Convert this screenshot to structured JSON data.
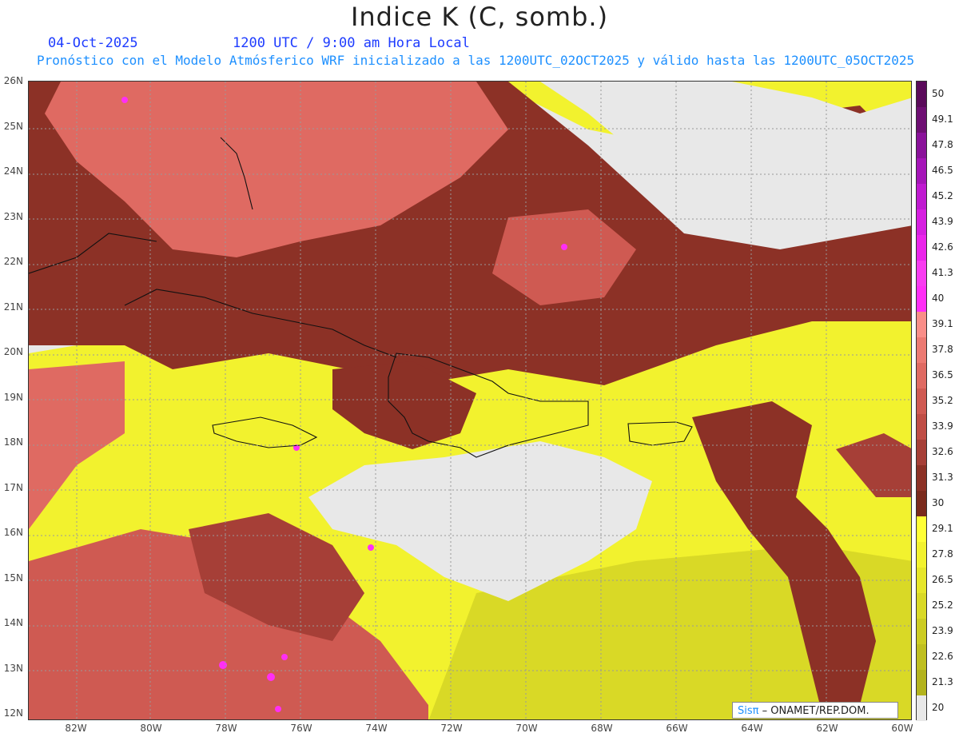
{
  "header": {
    "title": "Indice K (C, somb.)",
    "date": "04-Oct-2025",
    "time": "1200 UTC / 9:00 am Hora Local",
    "description": "Pronóstico con el Modelo Atmósferico WRF inicializado a las 1200UTC_02OCT2025 y válido hasta las  1200UTC_05OCT2025"
  },
  "axes": {
    "lat_labels": [
      "26N",
      "25N",
      "24N",
      "23N",
      "22N",
      "21N",
      "20N",
      "19N",
      "18N",
      "17N",
      "16N",
      "15N",
      "14N",
      "13N",
      "12N"
    ],
    "lon_labels": [
      "82W",
      "80W",
      "78W",
      "76W",
      "74W",
      "72W",
      "70W",
      "68W",
      "66W",
      "64W",
      "62W",
      "60W"
    ]
  },
  "legend": {
    "labels": [
      "50",
      "49.1",
      "47.8",
      "46.5",
      "45.2",
      "43.9",
      "42.6",
      "41.3",
      "40",
      "39.1",
      "37.8",
      "36.5",
      "35.2",
      "33.9",
      "32.6",
      "31.3",
      "30",
      "29.1",
      "27.8",
      "26.5",
      "25.2",
      "23.9",
      "22.6",
      "21.3",
      "20"
    ],
    "colors": [
      "#5a0a5a",
      "#6e0f73",
      "#8a129a",
      "#a515b8",
      "#bf1ad0",
      "#d61fe0",
      "#ea24ea",
      "#f83cf0",
      "#ff2ef5",
      "#f98e88",
      "#ec7a72",
      "#df6a62",
      "#cf5a52",
      "#bf4d45",
      "#a63f37",
      "#8c3126",
      "#7a2a1c",
      "#ffff35",
      "#f2f22e",
      "#e6e62a",
      "#d9d926",
      "#cccc22",
      "#bfbf1f",
      "#b3b31c",
      "#e8e8e8"
    ]
  },
  "credit": {
    "brand": "Sisπ",
    "text": " –  ONAMET/REP.DOM."
  }
}
